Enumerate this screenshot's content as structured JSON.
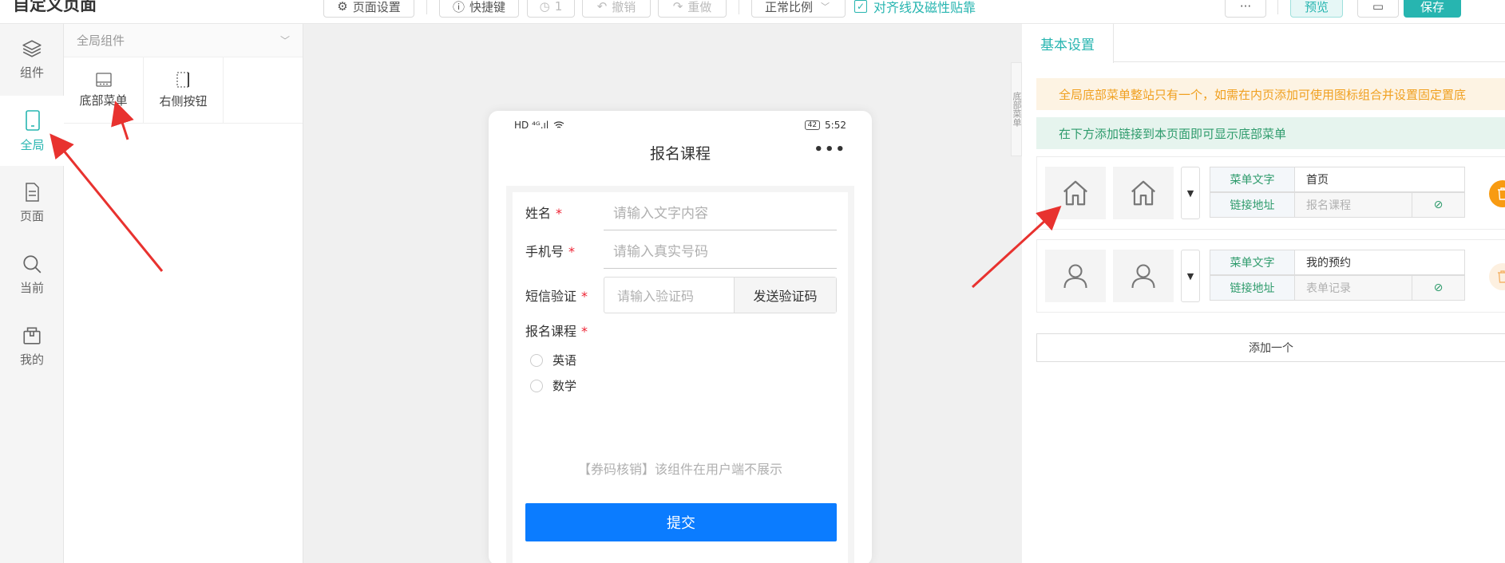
{
  "app": {
    "title": "自定义页面"
  },
  "toolbar": {
    "page_settings": "页面设置",
    "shortcuts": "快捷键",
    "history_count": "1",
    "undo": "撤销",
    "redo": "重做",
    "ratio": "正常比例",
    "snap_label": "对齐线及磁性贴靠",
    "more": "···",
    "preview": "预览",
    "save": "保存"
  },
  "rail": {
    "items": [
      {
        "label": "组件",
        "icon": "layers-icon"
      },
      {
        "label": "全局",
        "icon": "mobile-icon"
      },
      {
        "label": "页面",
        "icon": "document-icon"
      },
      {
        "label": "当前",
        "icon": "search-icon"
      },
      {
        "label": "我的",
        "icon": "box-icon"
      }
    ]
  },
  "components": {
    "header": "全局组件",
    "items": [
      {
        "label": "底部菜单",
        "icon": "bottom-menu-icon"
      },
      {
        "label": "右侧按钮",
        "icon": "right-button-icon"
      }
    ]
  },
  "phone": {
    "status_left": "HD ⁴ᴳ.ıl",
    "battery": "42",
    "time": "5:52",
    "title": "报名课程",
    "more": "•••",
    "form": {
      "name_label": "姓名",
      "name_placeholder": "请输入文字内容",
      "phone_label": "手机号",
      "phone_placeholder": "请输入真实号码",
      "sms_label": "短信验证",
      "sms_placeholder": "请输入验证码",
      "sms_button": "发送验证码",
      "course_label": "报名课程",
      "required": "*",
      "options": [
        "英语",
        "数学"
      ],
      "notice": "【券码核销】该组件在用户端不展示",
      "submit": "提交"
    }
  },
  "side_tab": {
    "label": "底部菜单"
  },
  "settings": {
    "tab": "基本设置",
    "tip_warning": "全局底部菜单整站只有一个，如需在内页添加可使用图标组合并设置固定置底",
    "tip_info": "在下方添加链接到本页面即可显示底部菜单",
    "menu_items": [
      {
        "icon": "home-icon",
        "text_key": "菜单文字",
        "text": "首页",
        "link_key": "链接地址",
        "link": "报名课程"
      },
      {
        "icon": "user-icon",
        "text_key": "菜单文字",
        "text": "我的预约",
        "link_key": "链接地址",
        "link": "表单记录"
      }
    ],
    "add_button": "添加一个"
  },
  "colors": {
    "accent": "#27b5b0",
    "primary_button": "#0b7cff",
    "warning": "#f0a020",
    "success": "#2e9b6c",
    "arrow": "#e8322f"
  }
}
